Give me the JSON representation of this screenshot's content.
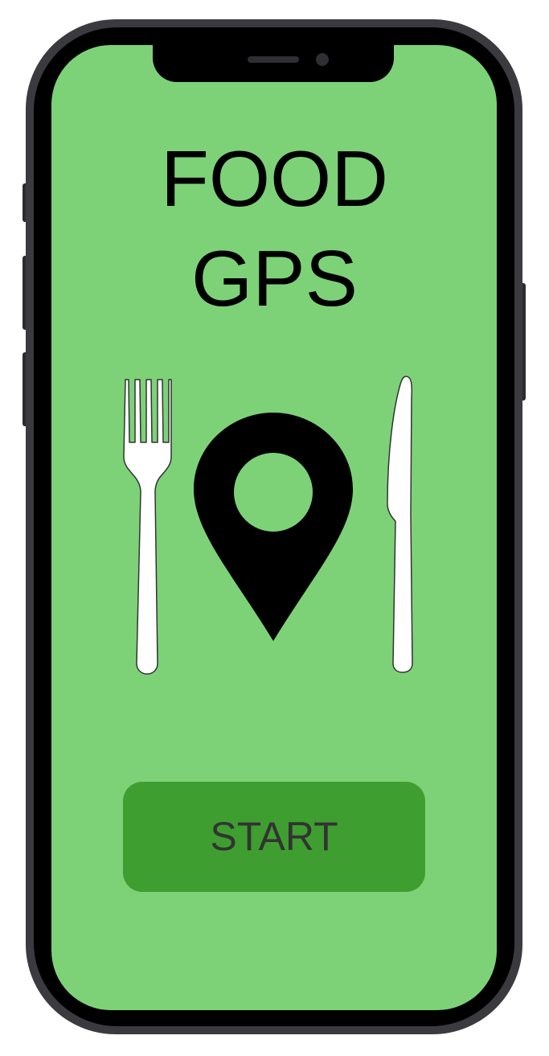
{
  "app": {
    "title_line1": "FOOD",
    "title_line2": "GPS"
  },
  "actions": {
    "start_label": "START"
  },
  "icons": {
    "fork": "fork-icon",
    "pin": "map-pin-icon",
    "knife": "knife-icon"
  },
  "colors": {
    "screen_background": "#7dd278",
    "button_background": "#3f9e30",
    "button_text": "#333333",
    "title_text": "#000000",
    "pin": "#000000"
  }
}
